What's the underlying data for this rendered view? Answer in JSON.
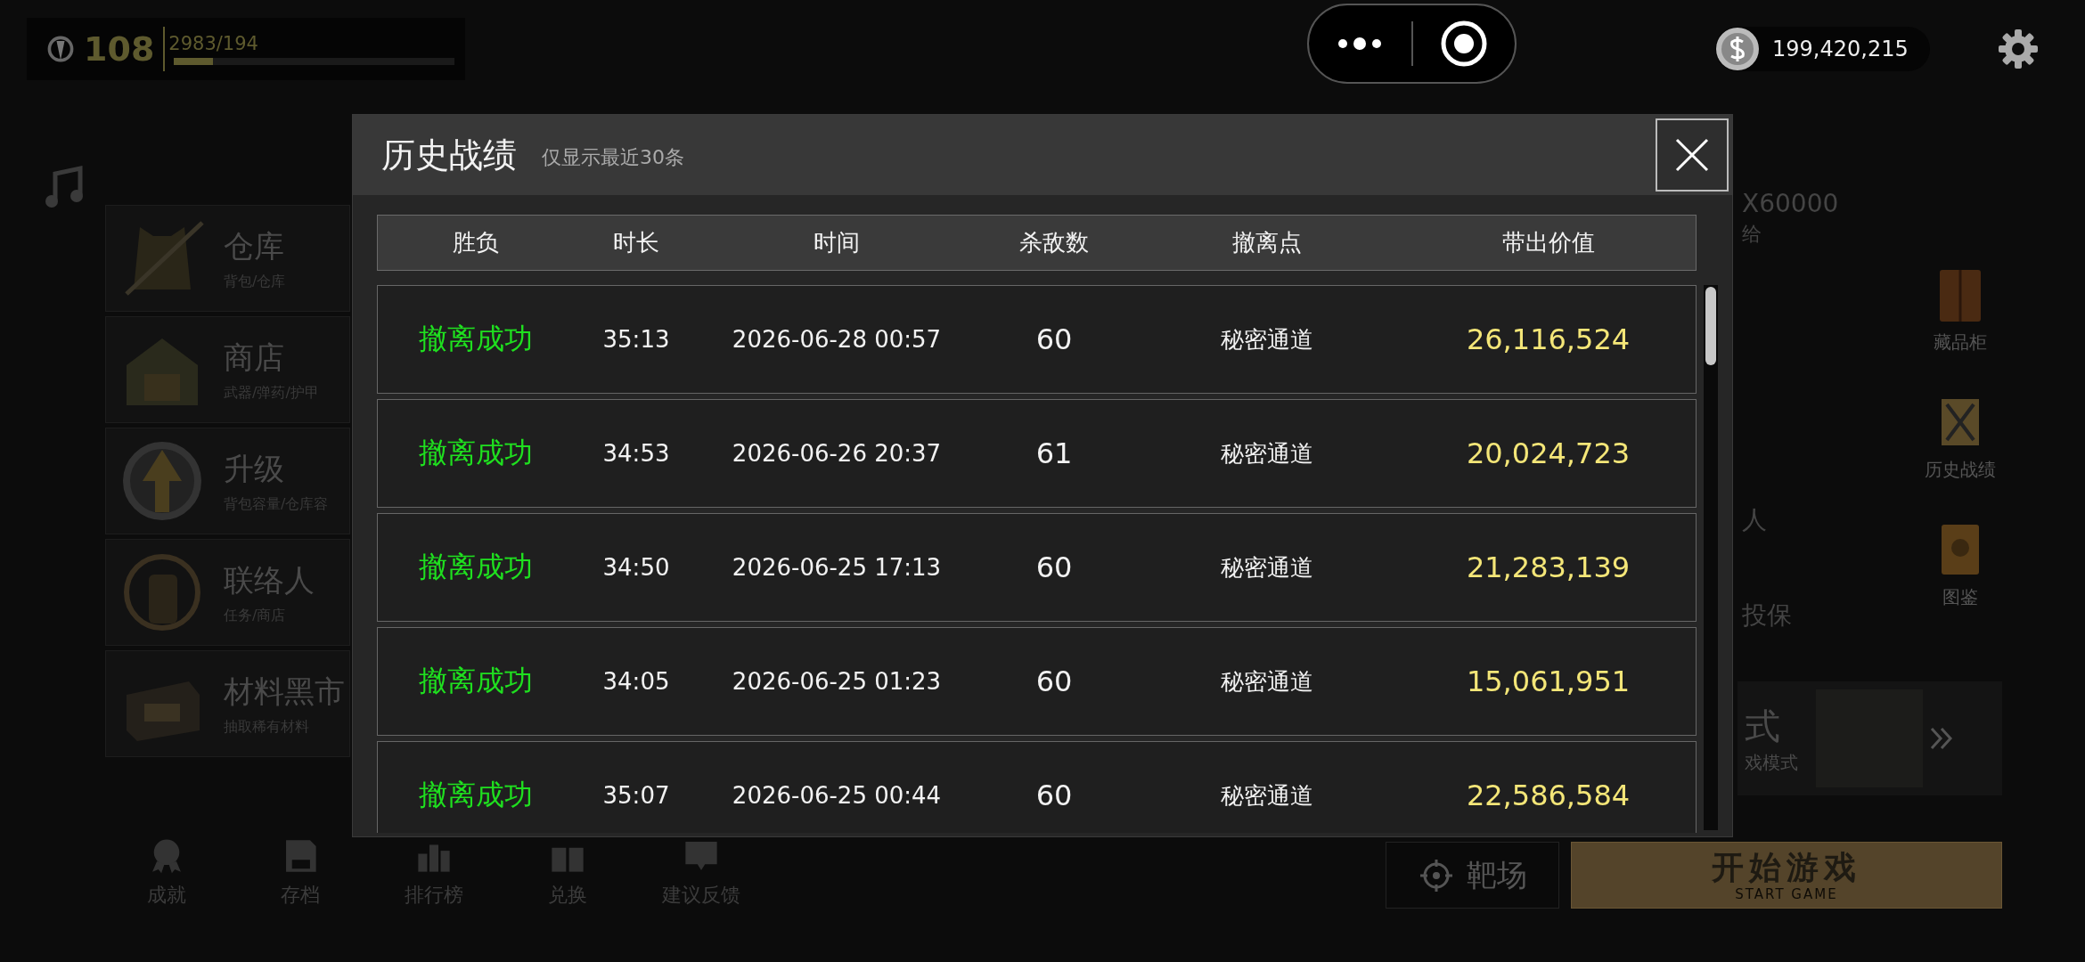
{
  "hud": {
    "level_number": "108",
    "xp_text": "2983/194",
    "xp_bar": {
      "level": 0.14
    }
  },
  "currency": {
    "amount": "199,420,215"
  },
  "menu": [
    {
      "title": "仓库",
      "subtitle": "背包/仓库"
    },
    {
      "title": "商店",
      "subtitle": "武器/弹药/护甲"
    },
    {
      "title": "升级",
      "subtitle": "背包容量/仓库容"
    },
    {
      "title": "联络人",
      "subtitle": "任务/商店"
    },
    {
      "title": "材料黑市",
      "subtitle": "抽取稀有材料"
    }
  ],
  "bottom_nav": [
    {
      "label": "成就"
    },
    {
      "label": "存档"
    },
    {
      "label": "排行榜"
    },
    {
      "label": "兑换"
    },
    {
      "label": "建议反馈"
    }
  ],
  "behind_modal": {
    "supply_count": "X60000",
    "supply_label": "给",
    "escort_label": "人",
    "insurance_label": "投保",
    "mode_title": "式",
    "mode_subtitle": "戏模式"
  },
  "right_shortcuts": [
    {
      "label": "藏品柜"
    },
    {
      "label": "历史战绩"
    },
    {
      "label": "图鉴"
    }
  ],
  "range_button": {
    "label": "靶场"
  },
  "start_button": {
    "label": "开始游戏",
    "sublabel": "START GAME"
  },
  "modal": {
    "title": "历史战绩",
    "subtitle": "仅显示最近30条",
    "columns": [
      "胜负",
      "时长",
      "时间",
      "杀敌数",
      "撤离点",
      "带出价值"
    ],
    "rows": [
      {
        "result": "撤离成功",
        "duration": "35:13",
        "time": "2026-06-28 00:57",
        "kills": "60",
        "extraction": "秘密通道",
        "value": "26,116,524"
      },
      {
        "result": "撤离成功",
        "duration": "34:53",
        "time": "2026-06-26 20:37",
        "kills": "61",
        "extraction": "秘密通道",
        "value": "20,024,723"
      },
      {
        "result": "撤离成功",
        "duration": "34:50",
        "time": "2026-06-25 17:13",
        "kills": "60",
        "extraction": "秘密通道",
        "value": "21,283,139"
      },
      {
        "result": "撤离成功",
        "duration": "34:05",
        "time": "2026-06-25 01:23",
        "kills": "60",
        "extraction": "秘密通道",
        "value": "15,061,951"
      },
      {
        "result": "撤离成功",
        "duration": "35:07",
        "time": "2026-06-25 00:44",
        "kills": "60",
        "extraction": "秘密通道",
        "value": "22,586,584"
      }
    ]
  }
}
